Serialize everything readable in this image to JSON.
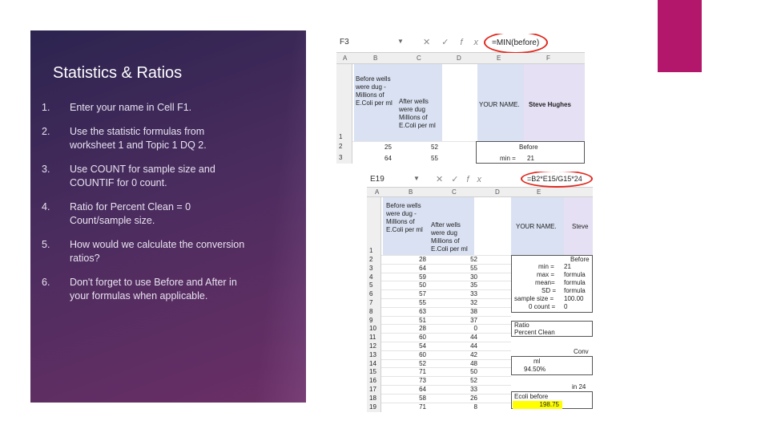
{
  "slide": {
    "title": "Statistics & Ratios",
    "items": [
      {
        "num": "1.",
        "text": "Enter your name in Cell F1."
      },
      {
        "num": "2.",
        "text": "Use the statistic formulas from worksheet 1 and Topic 1 DQ 2."
      },
      {
        "num": "3.",
        "text": "Use COUNT for sample size and COUNTIF for 0 count."
      },
      {
        "num": "4.",
        "text": "Ratio for Percent Clean = 0 Count/sample size."
      },
      {
        "num": "5.",
        "text": "How would we calculate the conversion ratios?"
      },
      {
        "num": "6.",
        "text": "Don't forget to use Before and After in your formulas when applicable."
      }
    ]
  },
  "colors": {
    "panel": "#3a2a58",
    "accent": "#b3176c",
    "circle": "#e0281e",
    "highlight": "#ffff00"
  },
  "excel_top": {
    "namebox": "F3",
    "formula": "=MIN(before)",
    "columns": [
      "A",
      "B",
      "C",
      "D",
      "E",
      "F"
    ],
    "rows": [
      "1",
      "2",
      "3"
    ],
    "before_header": "Before wells were dug - Millions of E.Coli per ml",
    "after_header": "After wells were dug Millions of E.Coli per ml",
    "your_name": "YOUR NAME.",
    "name_value": "Steve Hughes",
    "row2": {
      "before": "25",
      "after": "52",
      "f": "Before"
    },
    "row3": {
      "before": "64",
      "after": "55",
      "label": "min =",
      "value": "21"
    }
  },
  "excel_bottom": {
    "namebox": "E19",
    "formula": "=B2*E15/G15*24",
    "columns": [
      "A",
      "B",
      "C",
      "D",
      "E"
    ],
    "before_header": "Before wells were dug - Millions of E.Coli per ml",
    "after_header": "After wells were dug Millions of E.Coli per ml",
    "your_name": "YOUR NAME.",
    "name_value": "Steve",
    "rows": [
      {
        "n": "2",
        "b": "28",
        "c": "52"
      },
      {
        "n": "3",
        "b": "64",
        "c": "55"
      },
      {
        "n": "4",
        "b": "59",
        "c": "30"
      },
      {
        "n": "5",
        "b": "50",
        "c": "35"
      },
      {
        "n": "6",
        "b": "57",
        "c": "33"
      },
      {
        "n": "7",
        "b": "55",
        "c": "32"
      },
      {
        "n": "8",
        "b": "63",
        "c": "38"
      },
      {
        "n": "9",
        "b": "51",
        "c": "37"
      },
      {
        "n": "10",
        "b": "28",
        "c": "0"
      },
      {
        "n": "11",
        "b": "60",
        "c": "44"
      },
      {
        "n": "12",
        "b": "54",
        "c": "44"
      },
      {
        "n": "13",
        "b": "60",
        "c": "42"
      },
      {
        "n": "14",
        "b": "52",
        "c": "48"
      },
      {
        "n": "15",
        "b": "71",
        "c": "50"
      },
      {
        "n": "16",
        "b": "73",
        "c": "52"
      },
      {
        "n": "17",
        "b": "64",
        "c": "33"
      },
      {
        "n": "18",
        "b": "58",
        "c": "26"
      },
      {
        "n": "19",
        "b": "71",
        "c": "8"
      }
    ],
    "rownum_1": "1",
    "stats": [
      {
        "label": "Before",
        "value": ""
      },
      {
        "label": "min =",
        "value": "21"
      },
      {
        "label": "max =",
        "value": "formula"
      },
      {
        "label": "mean=",
        "value": "formula"
      },
      {
        "label": "SD =",
        "value": "formula"
      },
      {
        "label": "sample size =",
        "value": "100.00"
      },
      {
        "label": "0 count =",
        "value": "0"
      }
    ],
    "ratio": "Ratio",
    "percent_clean": "Percent Clean",
    "conv": "Conv",
    "ml": "ml",
    "pct": "94.50%",
    "in24": "in 24",
    "ecoli_before": "Ecoli before",
    "ecoli_value": "198.75"
  }
}
